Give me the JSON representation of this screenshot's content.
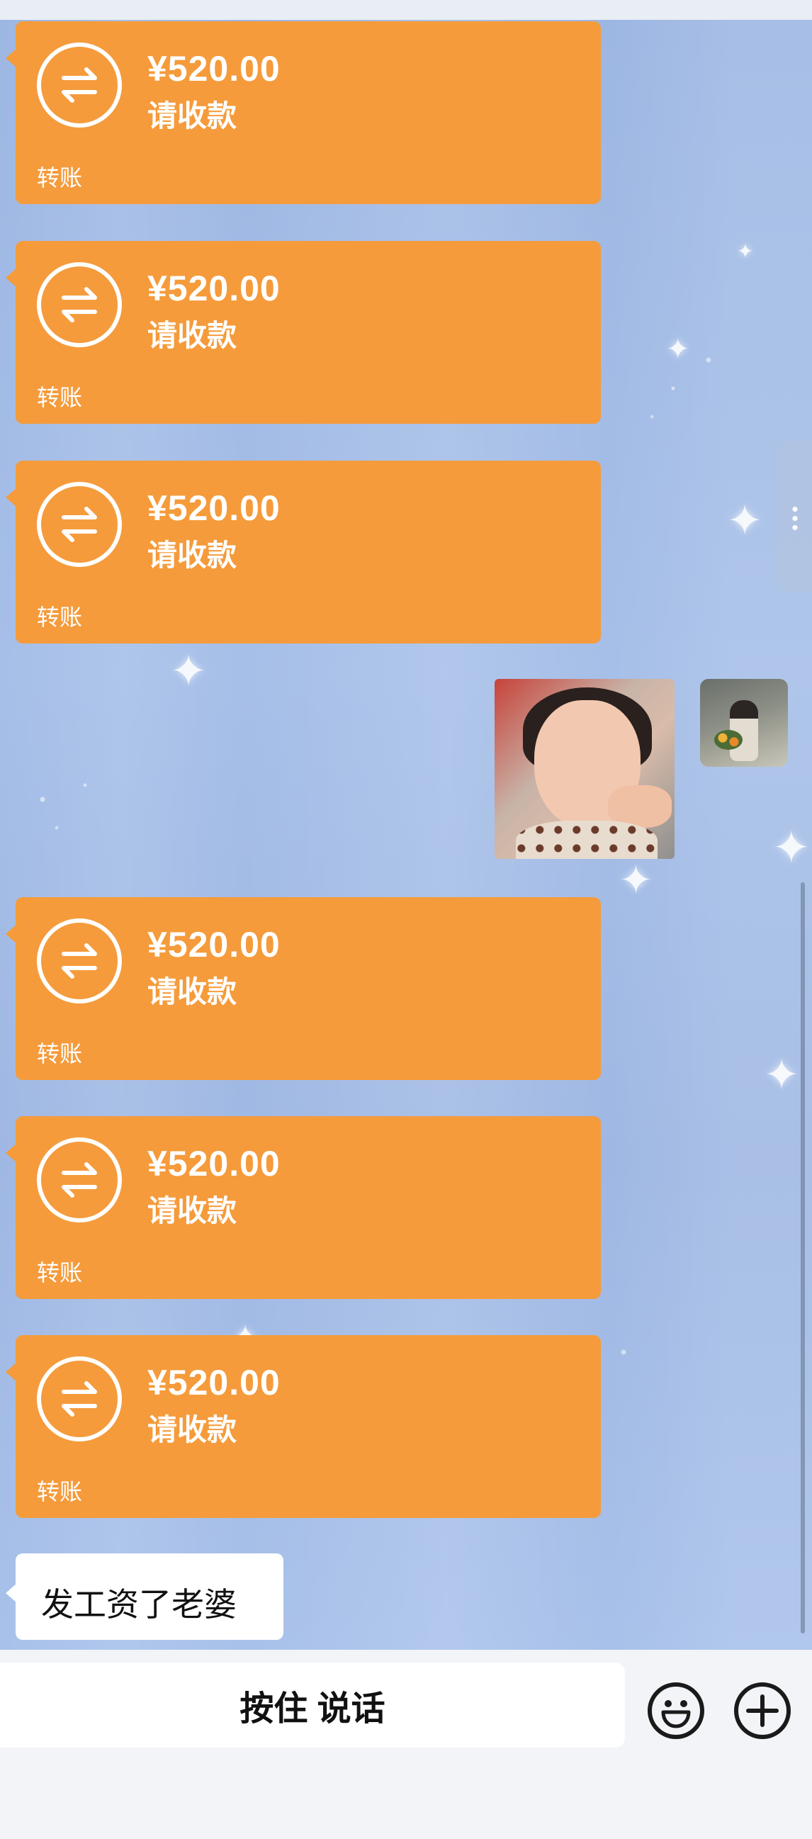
{
  "chat": {
    "transfers_before": [
      {
        "amount": "¥520.00",
        "status": "请收款",
        "label": "转账"
      },
      {
        "amount": "¥520.00",
        "status": "请收款",
        "label": "转账"
      },
      {
        "amount": "¥520.00",
        "status": "请收款",
        "label": "转账"
      }
    ],
    "transfers_after": [
      {
        "amount": "¥520.00",
        "status": "请收款",
        "label": "转账"
      },
      {
        "amount": "¥520.00",
        "status": "请收款",
        "label": "转账"
      },
      {
        "amount": "¥520.00",
        "status": "请收款",
        "label": "转账"
      }
    ],
    "last_message": "发工资了老婆"
  },
  "input_bar": {
    "voice_label": "按住 说话",
    "emoji_icon": "emoji-icon",
    "plus_icon": "plus-icon"
  },
  "colors": {
    "transfer_bubble": "#f59b3b",
    "chat_background": "#a6bfe8",
    "text_bubble": "#ffffff",
    "input_bar": "#f3f4f8"
  }
}
